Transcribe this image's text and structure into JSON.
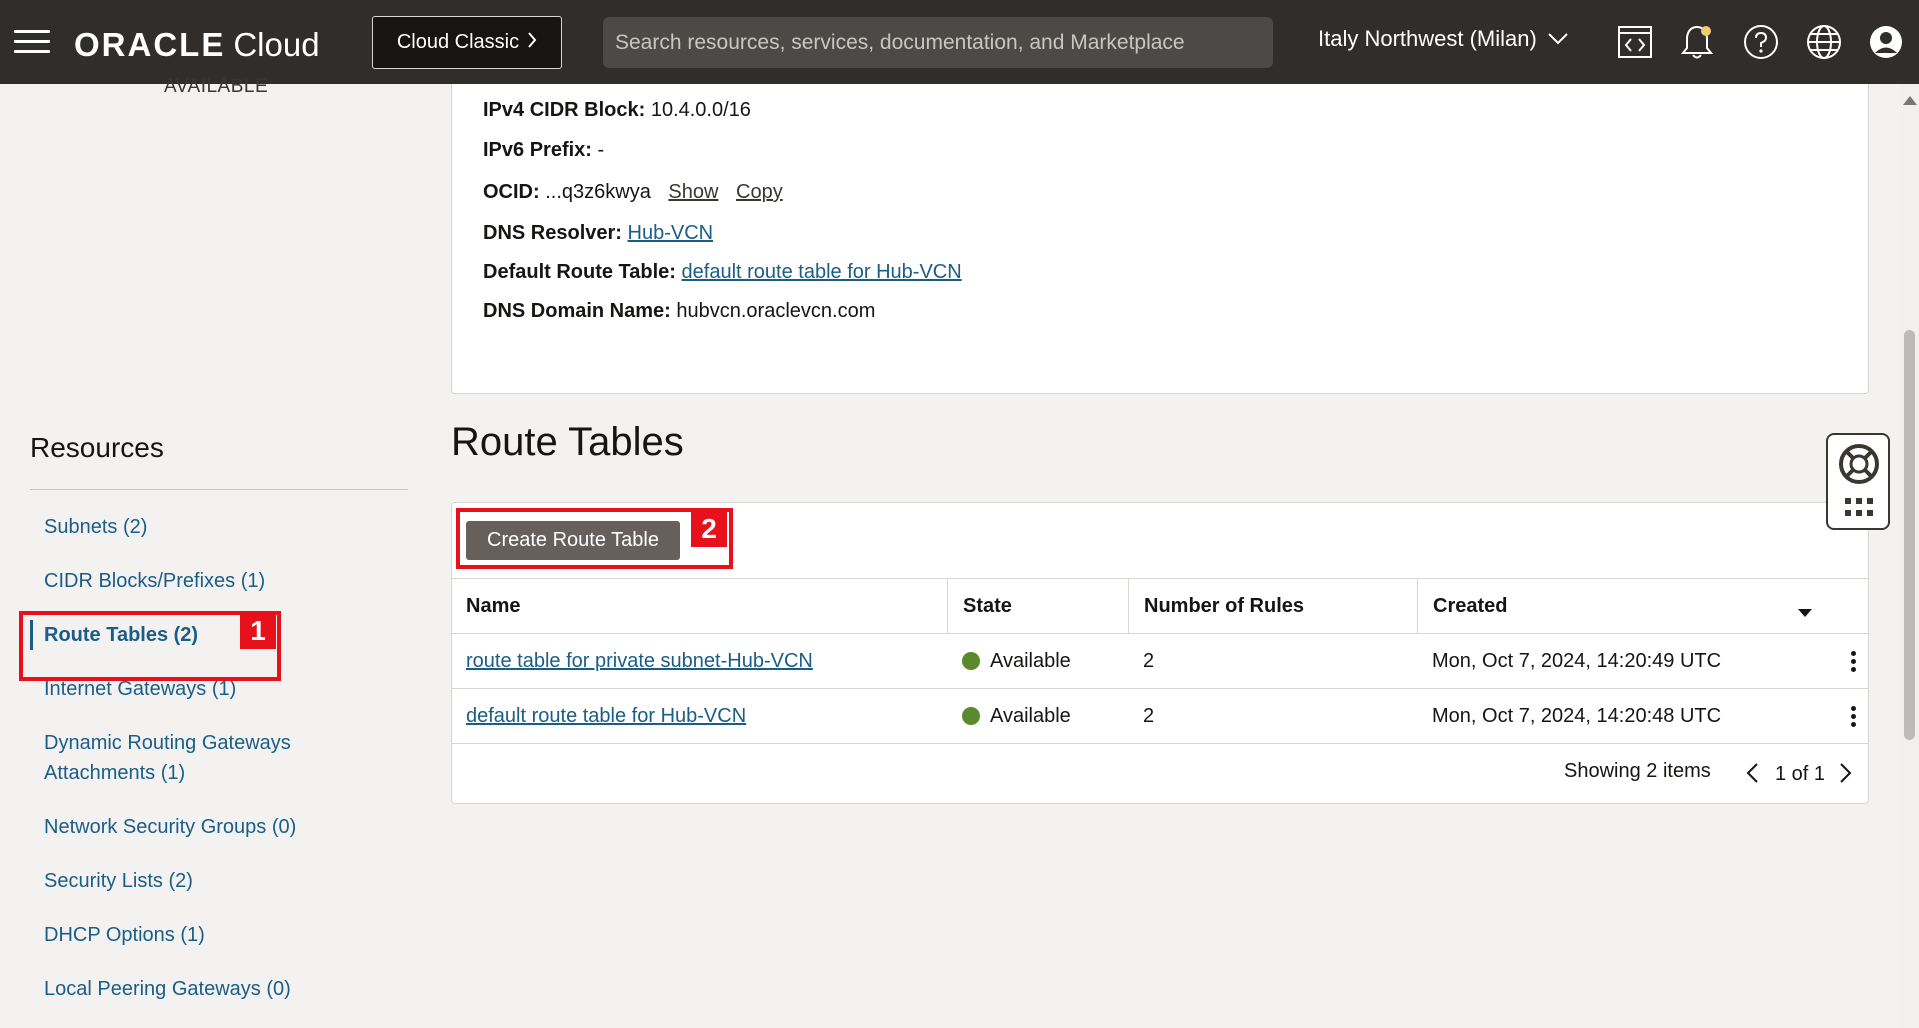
{
  "header": {
    "logo_oracle": "ORACLE",
    "logo_cloud": "Cloud",
    "classic_label": "Cloud Classic",
    "search_placeholder": "Search resources, services, documentation, and Marketplace",
    "region": "Italy Northwest (Milan)"
  },
  "top_status": "AVAILABLE",
  "details": {
    "ipv4_label": "IPv4 CIDR Block:",
    "ipv4_value": "10.4.0.0/16",
    "ipv6_label": "IPv6 Prefix:",
    "ipv6_value": "-",
    "ocid_label": "OCID:",
    "ocid_value": "...q3z6kwya",
    "ocid_show": "Show",
    "ocid_copy": "Copy",
    "dns_resolver_label": "DNS Resolver:",
    "dns_resolver_value": "Hub-VCN",
    "default_rt_label": "Default Route Table:",
    "default_rt_value": "default route table for Hub-VCN",
    "dns_domain_label": "DNS Domain Name:",
    "dns_domain_value": "hubvcn.oraclevcn.com"
  },
  "resources": {
    "title": "Resources",
    "items": [
      {
        "label": "Subnets (2)"
      },
      {
        "label": "CIDR Blocks/Prefixes (1)"
      },
      {
        "label": "Route Tables (2)"
      },
      {
        "label": "Internet Gateways (1)"
      },
      {
        "label": "Dynamic Routing Gateways Attachments (1)"
      },
      {
        "label": "Network Security Groups (0)"
      },
      {
        "label": "Security Lists (2)"
      },
      {
        "label": "DHCP Options (1)"
      },
      {
        "label": "Local Peering Gateways (0)"
      }
    ]
  },
  "annotations": {
    "one": "1",
    "two": "2"
  },
  "route_tables": {
    "title": "Route Tables",
    "create_label": "Create Route Table",
    "columns": [
      "Name",
      "State",
      "Number of Rules",
      "Created"
    ],
    "rows": [
      {
        "name": "route table for private subnet-Hub-VCN",
        "state": "Available",
        "rules": "2",
        "created": "Mon, Oct 7, 2024, 14:20:49 UTC"
      },
      {
        "name": "default route table for Hub-VCN",
        "state": "Available",
        "rules": "2",
        "created": "Mon, Oct 7, 2024, 14:20:48 UTC"
      }
    ],
    "showing": "Showing 2 items",
    "page": "1 of 1"
  },
  "colors": {
    "header_bg": "#312d2a",
    "link": "#1a5d86",
    "annotation": "#e8101a",
    "available": "#5a8a2e"
  }
}
